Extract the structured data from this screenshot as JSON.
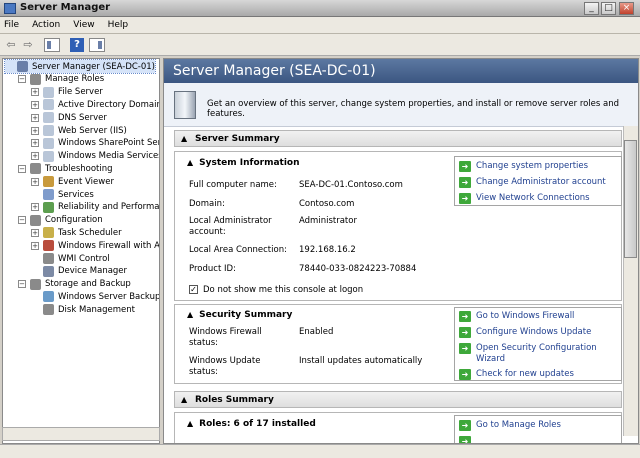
{
  "window": {
    "title": "Server Manager",
    "minimize": "_",
    "maximize": "□",
    "close": "×"
  },
  "menu": [
    "File",
    "Action",
    "View",
    "Help"
  ],
  "toolbar": {
    "back": "⇦",
    "forward": "⇨",
    "help": "?"
  },
  "tree": [
    {
      "label": "Server Manager (SEA-DC-01)",
      "level": 0,
      "exp": "",
      "color": "#6a7fa8",
      "selected": true
    },
    {
      "label": "Manage Roles",
      "level": 1,
      "exp": "−",
      "color": "#8a8a8a"
    },
    {
      "label": "File Server",
      "level": 2,
      "exp": "+",
      "color": "#b9c6d8"
    },
    {
      "label": "Active Directory Domain Se",
      "level": 2,
      "exp": "+",
      "color": "#b9c6d8"
    },
    {
      "label": "DNS Server",
      "level": 2,
      "exp": "+",
      "color": "#b9c6d8"
    },
    {
      "label": "Web Server (IIS)",
      "level": 2,
      "exp": "+",
      "color": "#b9c6d8"
    },
    {
      "label": "Windows SharePoint Servic",
      "level": 2,
      "exp": "+",
      "color": "#b9c6d8"
    },
    {
      "label": "Windows Media Services",
      "level": 2,
      "exp": "+",
      "color": "#b9c6d8"
    },
    {
      "label": "Troubleshooting",
      "level": 1,
      "exp": "−",
      "color": "#8a8a8a"
    },
    {
      "label": "Event Viewer",
      "level": 2,
      "exp": "+",
      "color": "#c89a3d"
    },
    {
      "label": "Services",
      "level": 2,
      "exp": "",
      "color": "#7f9ccc"
    },
    {
      "label": "Reliability and Performance",
      "level": 2,
      "exp": "+",
      "color": "#5c9e4f"
    },
    {
      "label": "Configuration",
      "level": 1,
      "exp": "−",
      "color": "#8a8a8a"
    },
    {
      "label": "Task Scheduler",
      "level": 2,
      "exp": "+",
      "color": "#c8b04a"
    },
    {
      "label": "Windows Firewall with Adva",
      "level": 2,
      "exp": "+",
      "color": "#b94c3c"
    },
    {
      "label": "WMI Control",
      "level": 2,
      "exp": "",
      "color": "#8a8a8a"
    },
    {
      "label": "Device Manager",
      "level": 2,
      "exp": "",
      "color": "#7c8aa5"
    },
    {
      "label": "Storage and Backup",
      "level": 1,
      "exp": "−",
      "color": "#8a8a8a"
    },
    {
      "label": "Windows Server Backup",
      "level": 2,
      "exp": "",
      "color": "#6a9bc9"
    },
    {
      "label": "Disk Management",
      "level": 2,
      "exp": "",
      "color": "#8a8a8a"
    }
  ],
  "main": {
    "title": "Server Manager (SEA-DC-01)",
    "description": "Get an overview of this server, change system properties, and install or remove server roles and features."
  },
  "server_summary": {
    "title": "Server Summary",
    "system_info": {
      "title": "System Information",
      "rows": [
        {
          "label": "Full computer name:",
          "value": "SEA-DC-01.Contoso.com"
        },
        {
          "label": "Domain:",
          "value": "Contoso.com"
        },
        {
          "label": "Local Administrator\naccount:",
          "value": "Administrator"
        },
        {
          "label": "Local Area Connection:",
          "value": "192.168.16.2"
        },
        {
          "label": "Product ID:",
          "value": "78440-033-0824223-70884"
        }
      ],
      "checkbox_label": "Do not show me this console at logon",
      "links": [
        "Change system properties",
        "Change Administrator account",
        "View Network Connections"
      ]
    },
    "security": {
      "title": "Security Summary",
      "rows": [
        {
          "label": "Windows Firewall\nstatus:",
          "value": "Enabled"
        },
        {
          "label": "Windows Update\nstatus:",
          "value": "Install updates automatically"
        }
      ],
      "links": [
        "Go to Windows Firewall",
        "Configure Windows Update",
        "Open Security Configuration\nWizard",
        "Check for new updates"
      ]
    }
  },
  "roles_summary": {
    "title": "Roles Summary",
    "roles_title": "Roles: 6 of 17 installed",
    "links": [
      "Go to Manage Roles"
    ]
  }
}
